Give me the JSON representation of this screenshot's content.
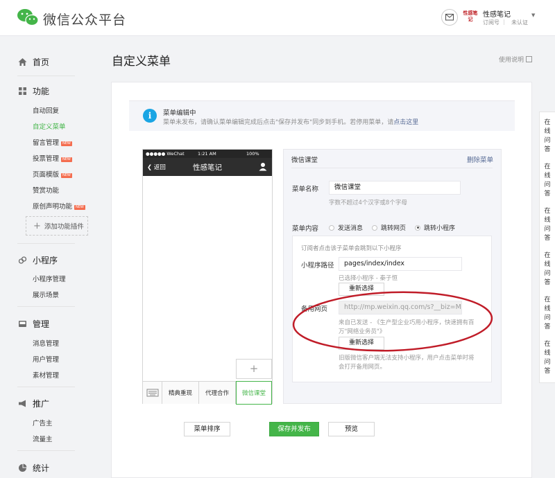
{
  "header": {
    "brand": "微信公众平台",
    "avatar_text": "性感笔记",
    "account_name": "性感笔记",
    "account_type": "订阅号",
    "account_sep": "|",
    "account_status": "未认证"
  },
  "sidebar": {
    "home": "首页",
    "func": "功能",
    "func_items": [
      {
        "label": "自动回复",
        "new": ""
      },
      {
        "label": "自定义菜单",
        "new": ""
      },
      {
        "label": "留言管理",
        "new": "NEW"
      },
      {
        "label": "投票管理",
        "new": "NEW"
      },
      {
        "label": "页面模版",
        "new": "NEW"
      },
      {
        "label": "赞赏功能",
        "new": ""
      },
      {
        "label": "原创声明功能",
        "new": "NEW"
      }
    ],
    "add_plugin": "添加功能插件",
    "mini": "小程序",
    "mini_items": [
      "小程序管理",
      "展示场景"
    ],
    "manage": "管理",
    "manage_items": [
      "消息管理",
      "用户管理",
      "素材管理"
    ],
    "promo": "推广",
    "promo_items": [
      "广告主",
      "流量主"
    ],
    "stats": "统计"
  },
  "main": {
    "title": "自定义菜单",
    "help": "使用说明",
    "notice_title": "菜单编辑中",
    "notice_text": "菜单未发布，请确认菜单编辑完成后点击\"保存并发布\"同步到手机。若停用菜单，请",
    "notice_link": "点击这里"
  },
  "phone": {
    "carrier": "●●●●● WeChat",
    "time": "1:21 AM",
    "battery": "100%",
    "back": "返回",
    "title": "性感笔记",
    "add": "+",
    "tabs": [
      "精典重现",
      "代理合作",
      "微信课堂"
    ]
  },
  "editor": {
    "head": "微信课堂",
    "delete": "删除菜单",
    "name_label": "菜单名称",
    "name_value": "微信课堂",
    "name_hint": "字数不超过4个汉字或8个字母",
    "content_label": "菜单内容",
    "options": [
      "发送消息",
      "跳转网页",
      "跳转小程序"
    ],
    "selected_option": 2,
    "sub_intro": "订阅者点击该子菜单会跳到以下小程序",
    "path_label": "小程序路径",
    "path_value": "pages/index/index",
    "path_hint": "已选择小程序 - 秦子恒",
    "reselect": "重新选择",
    "backup_label": "备用网页",
    "backup_value": "http://mp.weixin.qq.com/s?__biz=MzIx",
    "backup_hint_1": "来自已发送 - 《生产型企业巧用小程序，快速拥有百",
    "backup_hint_2": "万\"网络业务员\"》",
    "reselect_2": "重新选择",
    "bottom_hint_1": "旧版微信客户端无法支持小程序，用户点击菜单时将",
    "bottom_hint_2": "会打开备用网页。"
  },
  "buttons": {
    "sort": "菜单排序",
    "publish": "保存并发布",
    "preview": "预览"
  },
  "floater": [
    "在线问答",
    "在线问答",
    "在线问答",
    "在线问答",
    "在线问答",
    "在线问答"
  ],
  "colors": {
    "accent": "#44b549",
    "link": "#576b95",
    "info": "#1aa5e4",
    "annotation": "#c01c28"
  }
}
